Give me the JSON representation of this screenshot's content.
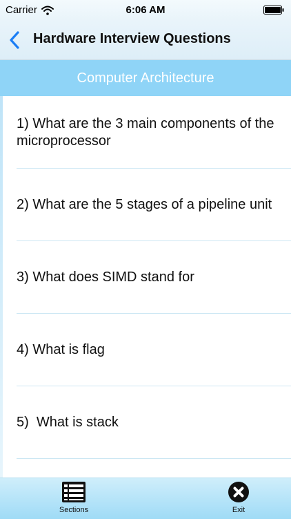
{
  "status_bar": {
    "carrier": "Carrier",
    "time": "6:06 AM",
    "wifi_icon": "wifi-icon",
    "battery_icon": "battery-icon"
  },
  "nav": {
    "title": "Hardware Interview Questions",
    "back_icon": "chevron-left-icon"
  },
  "section": {
    "title": "Computer Architecture"
  },
  "questions": [
    {
      "text": "1) What are the 3 main components of the microprocessor"
    },
    {
      "text": "2) What are the 5 stages of a pipeline unit"
    },
    {
      "text": "3) What does SIMD stand for"
    },
    {
      "text": "4) What is flag"
    },
    {
      "text": "5)  What is stack"
    }
  ],
  "tab_bar": {
    "sections_label": "Sections",
    "exit_label": "Exit",
    "sections_icon": "list-icon",
    "exit_icon": "close-circle-icon"
  },
  "colors": {
    "accent": "#1b7ef5",
    "section_header": "#8fd4f7",
    "tab_bar": "#aee0f7"
  }
}
